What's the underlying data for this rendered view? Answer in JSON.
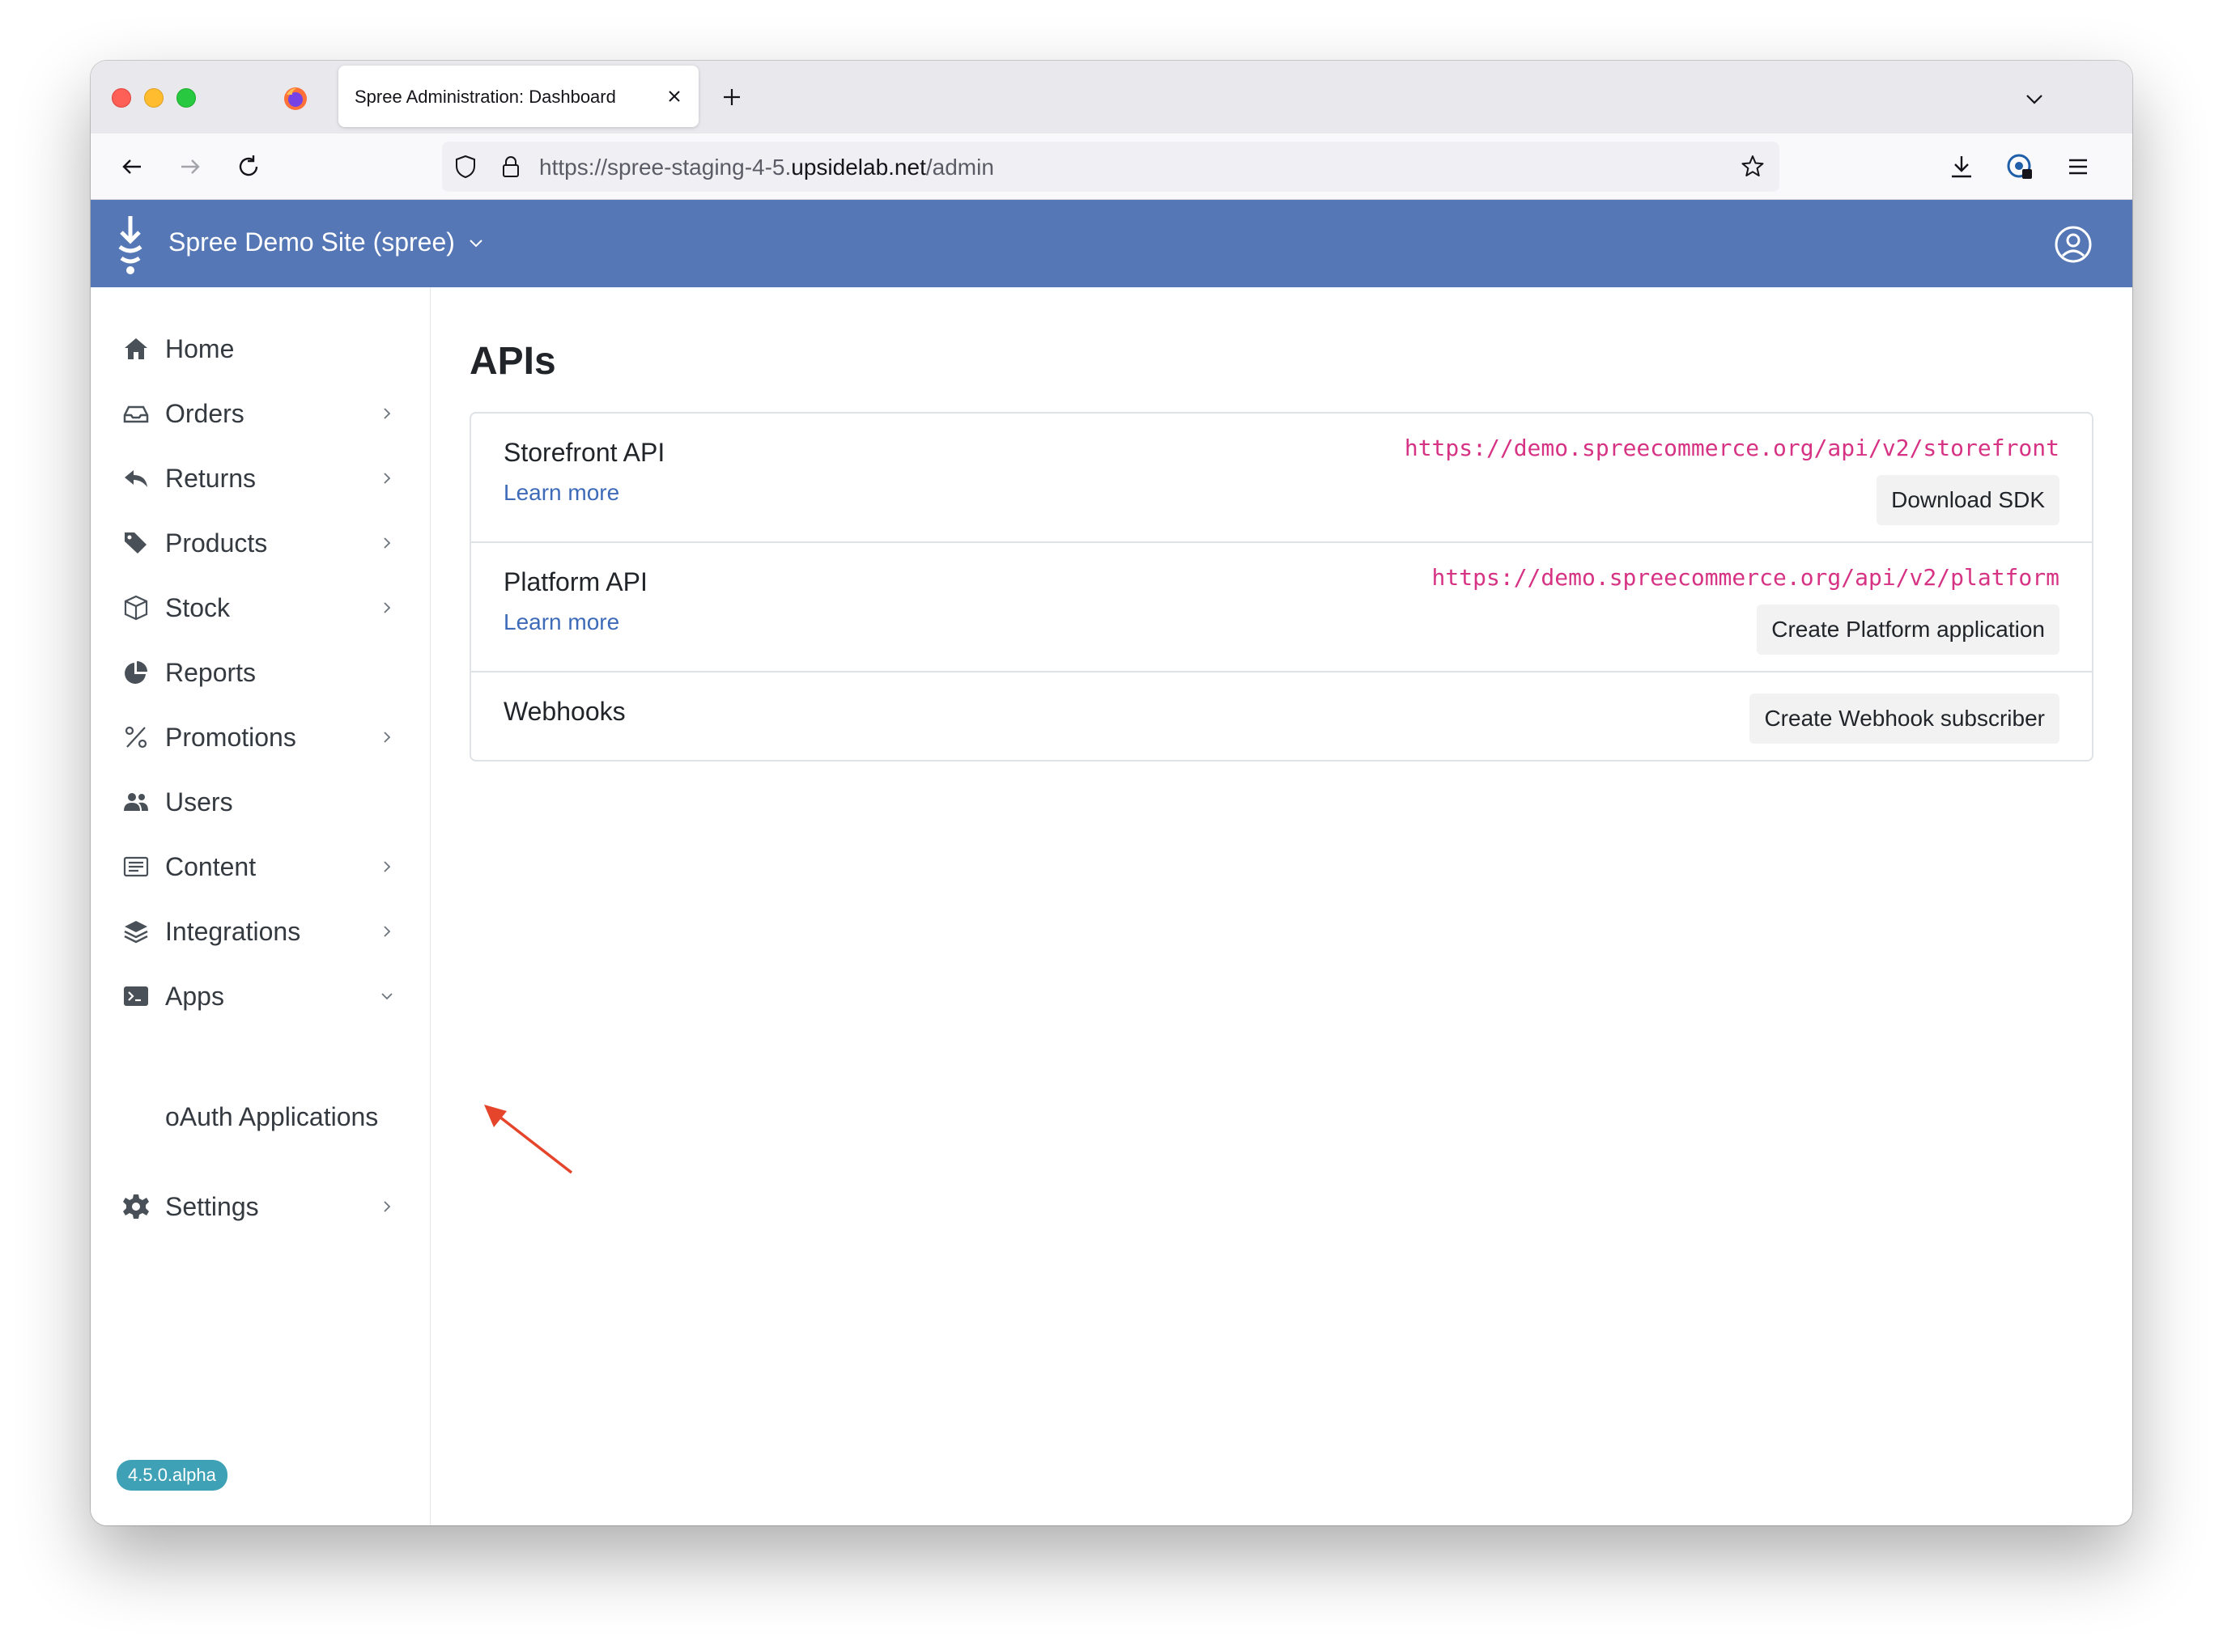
{
  "browser": {
    "tab_title": "Spree Administration: Dashboard",
    "url_prefix": "https://spree-staging-4-5.",
    "url_domain": "upsidelab.net",
    "url_path": "/admin"
  },
  "header": {
    "store_name": "Spree Demo Site (spree)",
    "brand_color": "#5677b5"
  },
  "sidebar": {
    "items": [
      {
        "label": "Home",
        "icon": "home-icon",
        "has_chevron": false
      },
      {
        "label": "Orders",
        "icon": "inbox-icon",
        "has_chevron": true
      },
      {
        "label": "Returns",
        "icon": "reply-icon",
        "has_chevron": true
      },
      {
        "label": "Products",
        "icon": "tags-icon",
        "has_chevron": true
      },
      {
        "label": "Stock",
        "icon": "box-icon",
        "has_chevron": true
      },
      {
        "label": "Reports",
        "icon": "pie-chart-icon",
        "has_chevron": false
      },
      {
        "label": "Promotions",
        "icon": "percent-icon",
        "has_chevron": true
      },
      {
        "label": "Users",
        "icon": "users-icon",
        "has_chevron": false
      },
      {
        "label": "Content",
        "icon": "content-icon",
        "has_chevron": true
      },
      {
        "label": "Integrations",
        "icon": "layers-icon",
        "has_chevron": true
      },
      {
        "label": "Apps",
        "icon": "terminal-icon",
        "has_chevron": true
      },
      {
        "label": "Settings",
        "icon": "gear-icon",
        "has_chevron": true
      }
    ],
    "submenu_item": "oAuth Applications",
    "version": "4.5.0.alpha"
  },
  "main": {
    "title": "APIs",
    "rows": [
      {
        "title": "Storefront API",
        "link": "Learn more",
        "url": "https://demo.spreecommerce.org/api/v2/storefront",
        "button": "Download SDK"
      },
      {
        "title": "Platform API",
        "link": "Learn more",
        "url": "https://demo.spreecommerce.org/api/v2/platform",
        "button": "Create Platform application"
      },
      {
        "title": "Webhooks",
        "button": "Create Webhook subscriber"
      }
    ]
  },
  "colors": {
    "url_pink": "#d63384",
    "link_blue": "#3d6bb8",
    "badge_teal": "#3fa1b6",
    "annotation_arrow": "#e4452b"
  }
}
